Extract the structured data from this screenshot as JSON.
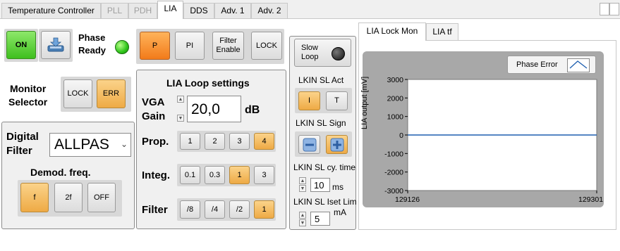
{
  "tabs": [
    {
      "label": "Temperature Controller",
      "state": "normal"
    },
    {
      "label": "PLL",
      "state": "dim"
    },
    {
      "label": "PDH",
      "state": "dim"
    },
    {
      "label": "LIA",
      "state": "active"
    },
    {
      "label": "DDS",
      "state": "normal"
    },
    {
      "label": "Adv. 1",
      "state": "normal"
    },
    {
      "label": "Adv. 2",
      "state": "normal"
    }
  ],
  "top": {
    "on_label": "ON",
    "phase_ready_label": "Phase\nReady",
    "p_label": "P",
    "pi_label": "PI",
    "filter_enable_label": "Filter\nEnable",
    "lock_label": "LOCK"
  },
  "monitor": {
    "title": "Monitor\nSelector",
    "lock_label": "LOCK",
    "err_label": "ERR"
  },
  "digital_filter": {
    "title": "Digital\nFilter",
    "value": "ALLPAS",
    "demod_title": "Demod. freq.",
    "f_label": "f",
    "f2_label": "2f",
    "off_label": "OFF"
  },
  "loop": {
    "title": "LIA Loop settings",
    "vga_label": "VGA\nGain",
    "vga_value": "20,0",
    "vga_unit": "dB",
    "prop_label": "Prop.",
    "prop_options": [
      "1",
      "2",
      "3",
      "4"
    ],
    "integ_label": "Integ.",
    "integ_options": [
      "0.1",
      "0.3",
      "1",
      "3"
    ],
    "filter_label": "Filter",
    "filter_options": [
      "/8",
      "/4",
      "/2",
      "1"
    ]
  },
  "lkin": {
    "slow_loop_label": "Slow\nLoop",
    "sl_act_label": "LKIN SL Act",
    "i_label": "I",
    "t_label": "T",
    "sl_sign_label": "LKIN SL Sign",
    "cy_time_label": "LKIN SL cy. time",
    "cy_time_value": "10",
    "cy_time_unit": "ms",
    "iset_label": "LKIN SL Iset Lim",
    "iset_value": "5",
    "iset_unit": "mA"
  },
  "monitor_tabs": [
    {
      "label": "LIA Lock Mon",
      "state": "active"
    },
    {
      "label": "LIA tf",
      "state": "normal"
    }
  ],
  "chart_data": {
    "type": "line",
    "legend": "Phase Error",
    "ylabel": "LIA output [mV]",
    "ylim": [
      -3000,
      3000
    ],
    "yticks": [
      "3000",
      "2000",
      "1000",
      "0",
      "-1000",
      "-2000",
      "-3000"
    ],
    "xlim": [
      129126,
      129301
    ],
    "xticks": [
      "129126",
      "129301"
    ],
    "series": [
      {
        "name": "Phase Error",
        "x": [
          129126,
          129301
        ],
        "y": [
          0,
          0
        ]
      }
    ]
  }
}
